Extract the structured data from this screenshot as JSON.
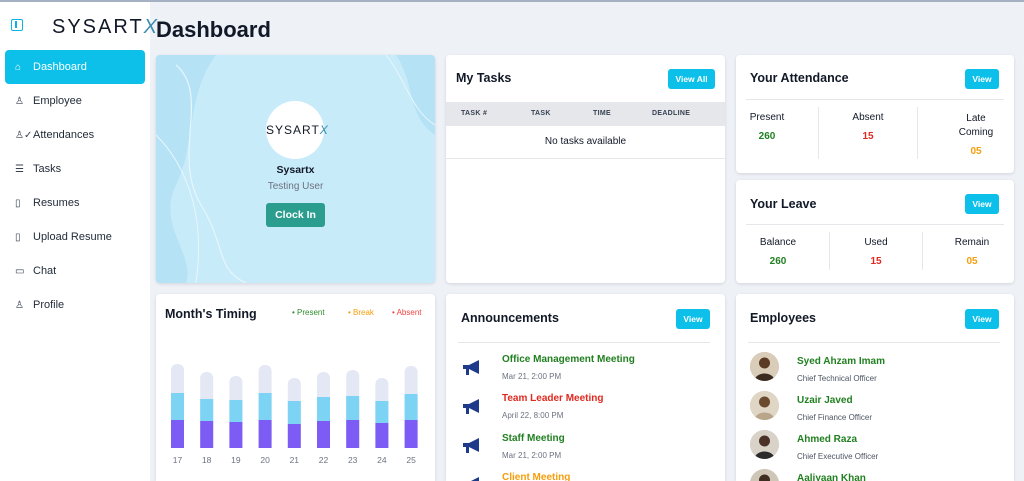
{
  "brand": {
    "logo_text": "SYSART",
    "logo_x": "X"
  },
  "sidebar": {
    "items": [
      {
        "label": "Dashboard",
        "icon": "home-icon",
        "active": true
      },
      {
        "label": "Employee",
        "icon": "user-icon"
      },
      {
        "label": "Attendances",
        "icon": "user-check-icon"
      },
      {
        "label": "Tasks",
        "icon": "list-icon"
      },
      {
        "label": "Resumes",
        "icon": "file-icon"
      },
      {
        "label": "Upload Resume",
        "icon": "file-icon"
      },
      {
        "label": "Chat",
        "icon": "chat-icon"
      },
      {
        "label": "Profile",
        "icon": "user-icon"
      }
    ]
  },
  "page": {
    "title": "Dashboard"
  },
  "profile": {
    "avatar_text": "SYSART",
    "avatar_x": "X",
    "name": "Sysartx",
    "role": "Testing User",
    "clock_in_label": "Clock In"
  },
  "tasks": {
    "title": "My Tasks",
    "view_all_label": "View All",
    "columns": [
      "TASK #",
      "TASK",
      "TIME",
      "DEADLINE"
    ],
    "empty_text": "No tasks available"
  },
  "attendance": {
    "title": "Your Attendance",
    "view_label": "View",
    "present_label": "Present",
    "present_value": "260",
    "absent_label": "Absent",
    "absent_value": "15",
    "late_label_1": "Late",
    "late_label_2": "Coming",
    "late_value": "05"
  },
  "leave": {
    "title": "Your Leave",
    "view_label": "View",
    "balance_label": "Balance",
    "balance_value": "260",
    "used_label": "Used",
    "used_value": "15",
    "remain_label": "Remain",
    "remain_value": "05"
  },
  "timing": {
    "title": "Month's Timing",
    "legend": {
      "present": "Present",
      "break": "Break",
      "absent": "Absent"
    },
    "colors": {
      "present": "#2e8b2e",
      "break": "#f59e0b",
      "absent": "#ef4444",
      "bar_top": "#e3e8f4",
      "bar_mid": "#7dd3f3",
      "bar_bottom": "#7c5cf5"
    }
  },
  "chart_data": {
    "type": "bar",
    "categories": [
      "17",
      "18",
      "19",
      "20",
      "21",
      "22",
      "23",
      "24",
      "25"
    ],
    "series": [
      {
        "values": [
          28,
          27,
          26,
          28,
          24,
          27,
          28,
          25,
          28
        ]
      },
      {
        "values": [
          27,
          22,
          22,
          27,
          23,
          24,
          24,
          22,
          26
        ]
      },
      {
        "values": [
          29,
          27,
          24,
          28,
          23,
          25,
          26,
          23,
          28
        ]
      }
    ]
  },
  "announcements": {
    "title": "Announcements",
    "view_label": "View",
    "items": [
      {
        "title": "Office Management Meeting",
        "date": "Mar 21, 2:00 PM",
        "color": "#218021"
      },
      {
        "title": "Team Leader Meeting",
        "date": "April 22, 8:00 PM",
        "color": "#e0281f"
      },
      {
        "title": "Staff Meeting",
        "date": "Mar 21, 2:00 PM",
        "color": "#218021"
      },
      {
        "title": "Client Meeting",
        "date": "",
        "color": "#f59e0b"
      }
    ]
  },
  "employees": {
    "title": "Employees",
    "view_label": "View",
    "items": [
      {
        "name": "Syed Ahzam Imam",
        "role": "Chief Technical Officer"
      },
      {
        "name": "Uzair Javed",
        "role": "Chief Finance Officer"
      },
      {
        "name": "Ahmed Raza",
        "role": "Chief Executive Officer"
      },
      {
        "name": "Aaliyaan Khan",
        "role": ""
      }
    ]
  }
}
